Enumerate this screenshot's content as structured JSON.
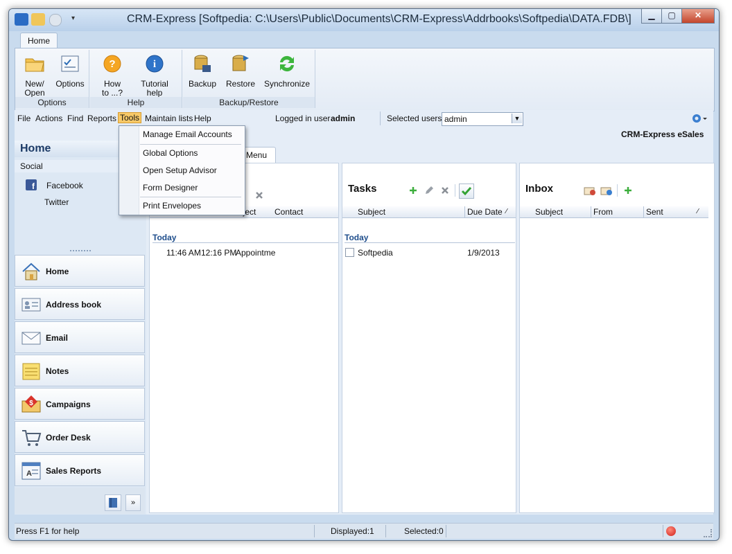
{
  "window": {
    "title": "CRM-Express [Softpedia: C:\\Users\\Public\\Documents\\CRM-Express\\Addrbooks\\Softpedia\\DATA.FDB\\]",
    "ribbon_tab": "Home",
    "accent": "#1f4e8c"
  },
  "ribbon": {
    "groups": [
      {
        "label": "Options",
        "buttons": [
          {
            "label": "New/\nOpen",
            "icon": "folder-icon"
          },
          {
            "label": "Options",
            "icon": "options-icon"
          }
        ]
      },
      {
        "label": "Help",
        "buttons": [
          {
            "label": "How\nto ...?",
            "icon": "question-icon"
          },
          {
            "label": "Tutorial\nhelp",
            "icon": "info-icon"
          }
        ]
      },
      {
        "label": "Backup/Restore",
        "buttons": [
          {
            "label": "Backup",
            "icon": "backup-icon"
          },
          {
            "label": "Restore",
            "icon": "restore-icon"
          },
          {
            "label": "Synchronize",
            "icon": "sync-icon"
          }
        ]
      }
    ]
  },
  "menubar": {
    "items": [
      "File",
      "Actions",
      "Find",
      "Reports",
      "Tools",
      "Maintain lists",
      "Help"
    ],
    "logged_in_label": "Logged in user",
    "logged_in_user": "admin",
    "selected_users_label": "Selected users",
    "selected_users_value": "admin",
    "brand": "CRM-Express eSales"
  },
  "tools_menu": [
    "Manage Email Accounts",
    "Global Options",
    "Open Setup Advisor",
    "Form Designer",
    "Print Envelopes"
  ],
  "sidebar": {
    "title": "Home",
    "section": "Social",
    "social": [
      "Facebook",
      "Twitter"
    ],
    "nav": [
      "Home",
      "Address book",
      "Email",
      "Notes",
      "Campaigns",
      "Order Desk",
      "Sales Reports"
    ]
  },
  "tab_fragment": "Menu",
  "appointments": {
    "columns": [
      "bject",
      "Contact"
    ],
    "group": "Today",
    "rows": [
      {
        "start": "11:46 AM",
        "end": "12:16 PM",
        "subject": "Appointme"
      }
    ]
  },
  "tasks": {
    "title": "Tasks",
    "columns": [
      "Subject",
      "Due Date"
    ],
    "group": "Today",
    "rows": [
      {
        "subject": "Softpedia",
        "due": "1/9/2013"
      }
    ]
  },
  "inbox": {
    "title": "Inbox",
    "columns": [
      "Subject",
      "From",
      "Sent"
    ]
  },
  "status": {
    "help": "Press F1 for help",
    "displayed": "Displayed:1",
    "selected": "Selected:0"
  }
}
